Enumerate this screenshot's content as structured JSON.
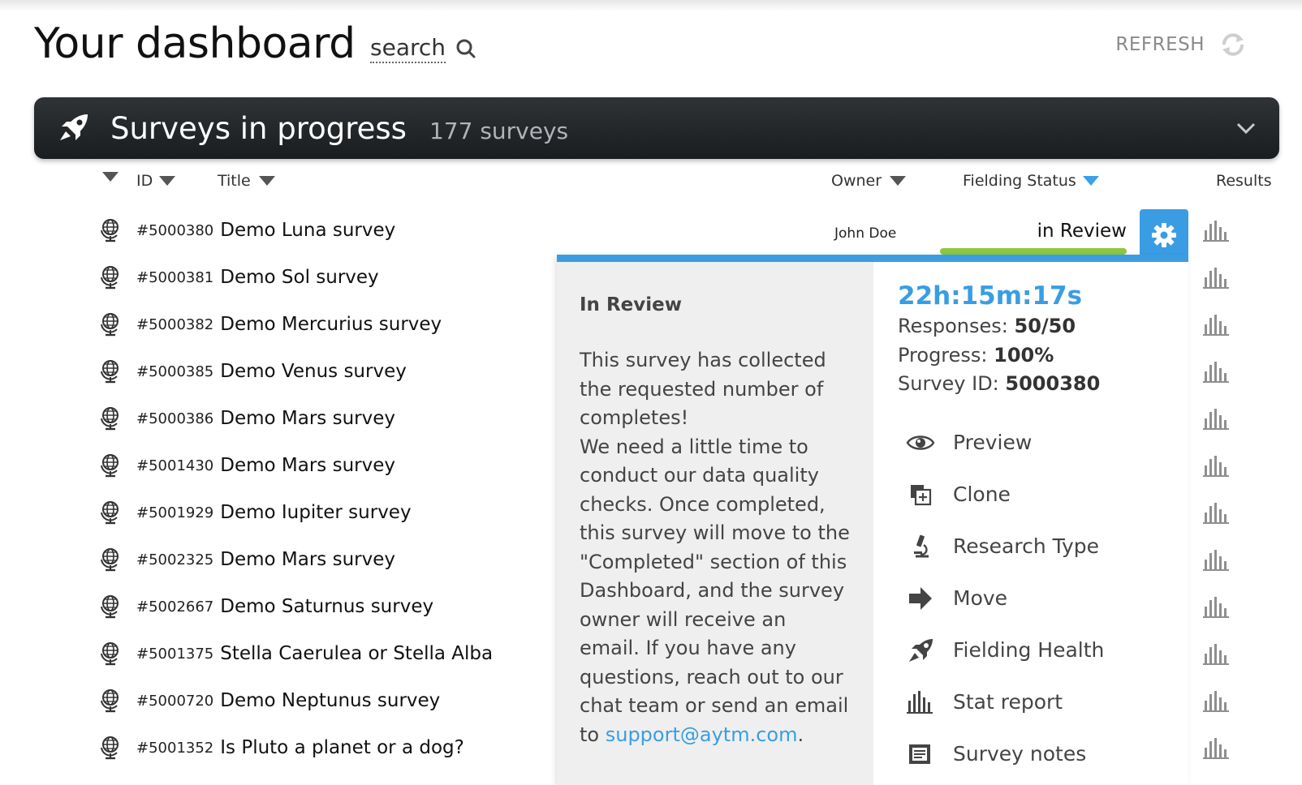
{
  "page": {
    "title": "Your dashboard"
  },
  "search": {
    "label": "search"
  },
  "refresh": {
    "label": "REFRESH"
  },
  "banner": {
    "title": "Surveys in progress",
    "count": "177 surveys"
  },
  "columns": {
    "id": "ID",
    "title": "Title",
    "owner": "Owner",
    "fielding_status": "Fielding Status",
    "results": "Results"
  },
  "rows": [
    {
      "id": "#5000380",
      "title": "Demo Luna survey"
    },
    {
      "id": "#5000381",
      "title": "Demo Sol survey"
    },
    {
      "id": "#5000382",
      "title": "Demo Mercurius survey"
    },
    {
      "id": "#5000385",
      "title": "Demo Venus survey"
    },
    {
      "id": "#5000386",
      "title": "Demo Mars survey"
    },
    {
      "id": "#5001430",
      "title": "Demo Mars survey"
    },
    {
      "id": "#5001929",
      "title": "Demo Iupiter survey"
    },
    {
      "id": "#5002325",
      "title": "Demo Mars survey"
    },
    {
      "id": "#5002667",
      "title": "Demo Saturnus survey"
    },
    {
      "id": "#5001375",
      "title": "Stella Caerulea or Stella Alba"
    },
    {
      "id": "#5000720",
      "title": "Demo Neptunus survey"
    },
    {
      "id": "#5001352",
      "title": "Is Pluto a planet or a dog?"
    }
  ],
  "selected_row": {
    "owner": "John Doe",
    "status": "in Review",
    "status_progress": 1.0
  },
  "popup": {
    "heading": "In Review",
    "body_1": "This survey has collected the requested number of completes!",
    "body_2": "We need a little time to conduct our data quality checks. Once completed, this survey will move to the \"Completed\" section of this Dashboard, and the survey owner will receive an email. If you have any questions, reach out to our chat team or send an email to",
    "email": "support@aytm.com",
    "email_suffix": ".",
    "timer": "22h:15m:17s",
    "responses_label": "Responses:",
    "responses_value": "50/50",
    "progress_label": "Progress:",
    "progress_value": "100%",
    "survey_id_label": "Survey ID:",
    "survey_id_value": "5000380",
    "actions": [
      {
        "label": "Preview",
        "icon": "eye-icon"
      },
      {
        "label": "Clone",
        "icon": "clone-icon"
      },
      {
        "label": "Research Type",
        "icon": "microscope-icon"
      },
      {
        "label": "Move",
        "icon": "arrow-right-icon"
      },
      {
        "label": "Fielding Health",
        "icon": "rocket-icon"
      },
      {
        "label": "Stat report",
        "icon": "bar-chart-icon"
      },
      {
        "label": "Survey notes",
        "icon": "notes-icon"
      }
    ]
  },
  "colors": {
    "accent": "#3a9de3",
    "status_green": "#8dc63f",
    "banner_bg": "#1f2326"
  }
}
